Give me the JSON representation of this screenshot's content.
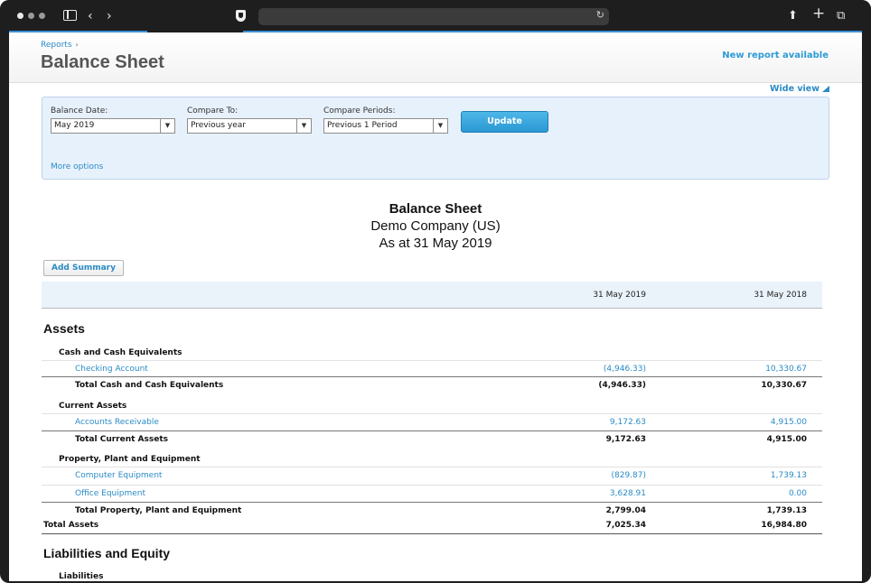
{
  "page": {
    "breadcrumb": "Reports",
    "title": "Balance Sheet",
    "new_report_link": "New report available",
    "wide_view_link": "Wide view"
  },
  "filters": {
    "balance_date_label": "Balance Date:",
    "balance_date_value": "May 2019",
    "compare_to_label": "Compare To:",
    "compare_to_value": "Previous year",
    "compare_periods_label": "Compare Periods:",
    "compare_periods_value": "Previous 1 Period",
    "update_label": "Update",
    "more_options": "More options"
  },
  "report": {
    "title": "Balance Sheet",
    "company": "Demo Company (US)",
    "as_at": "As at 31 May 2019",
    "add_summary": "Add Summary",
    "columns": [
      "31 May 2019",
      "31 May 2018"
    ],
    "assets_title": "Assets",
    "cash_group": "Cash and Cash Equivalents",
    "cash_rows": [
      {
        "name": "Checking Account",
        "v1": "(4,946.33)",
        "v2": "10,330.67"
      }
    ],
    "cash_total": {
      "name": "Total Cash and Cash Equivalents",
      "v1": "(4,946.33)",
      "v2": "10,330.67"
    },
    "current_group": "Current Assets",
    "current_rows": [
      {
        "name": "Accounts Receivable",
        "v1": "9,172.63",
        "v2": "4,915.00"
      }
    ],
    "current_total": {
      "name": "Total Current Assets",
      "v1": "9,172.63",
      "v2": "4,915.00"
    },
    "ppe_group": "Property, Plant and Equipment",
    "ppe_rows": [
      {
        "name": "Computer Equipment",
        "v1": "(829.87)",
        "v2": "1,739.13"
      },
      {
        "name": "Office Equipment",
        "v1": "3,628.91",
        "v2": "0.00"
      }
    ],
    "ppe_total": {
      "name": "Total Property, Plant and Equipment",
      "v1": "2,799.04",
      "v2": "1,739.13"
    },
    "total_assets": {
      "name": "Total Assets",
      "v1": "7,025.34",
      "v2": "16,984.80"
    },
    "liab_equity_title": "Liabilities and Equity",
    "liabilities_group": "Liabilities"
  }
}
